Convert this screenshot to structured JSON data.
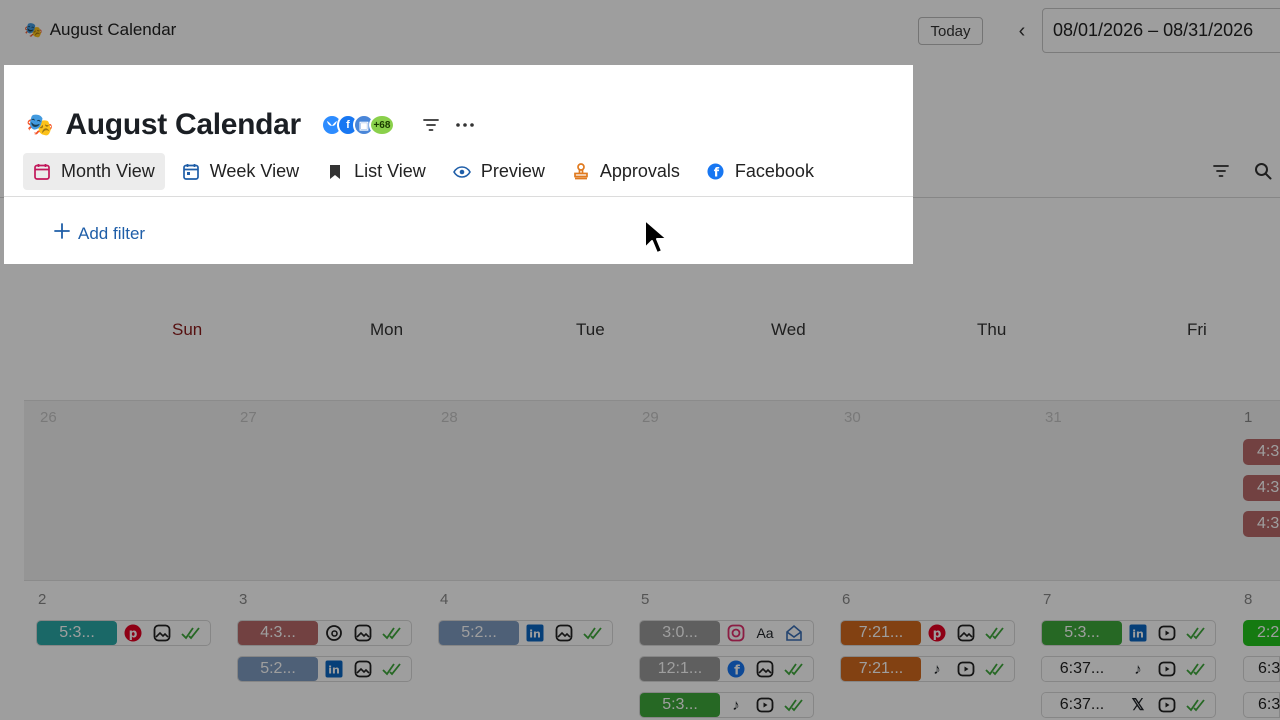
{
  "app": {
    "title": "August Calendar",
    "emoji": "🎭"
  },
  "topbar": {
    "today_label": "Today",
    "prev_label": "‹",
    "date_range": "08/01/2026  – 08/31/2026"
  },
  "panel": {
    "title": "August Calendar",
    "emoji": "🎭",
    "avatar_count": "+68",
    "tabs": [
      {
        "label": "Month View",
        "icon": "calendar-icon",
        "active": true
      },
      {
        "label": "Week View",
        "icon": "calendar-icon"
      },
      {
        "label": "List View",
        "icon": "bookmark-icon"
      },
      {
        "label": "Preview",
        "icon": "eye-icon"
      },
      {
        "label": "Approvals",
        "icon": "stamp-icon"
      },
      {
        "label": "Facebook",
        "icon": "facebook-icon"
      }
    ],
    "add_filter_label": "Add filter"
  },
  "calendar": {
    "weekdays": [
      "Sun",
      "Mon",
      "Tue",
      "Wed",
      "Thu",
      "Fri"
    ],
    "row1_days": [
      "26",
      "27",
      "28",
      "29",
      "30",
      "31",
      "1"
    ],
    "row2_days": [
      "2",
      "3",
      "4",
      "5",
      "6",
      "7",
      "8"
    ],
    "events": {
      "sun": [
        "5:3..."
      ],
      "mon": [
        "4:3...",
        "5:2..."
      ],
      "tue": [
        "5:2..."
      ],
      "wed": [
        "3:0...",
        "12:1...",
        "5:3..."
      ],
      "thu": [
        "7:21...",
        "7:21..."
      ],
      "fri": [
        "5:3...",
        "6:37...",
        "6:37..."
      ],
      "sat_row1": [
        "4:3",
        "4:3",
        "4:3"
      ],
      "sat_row2": [
        "2:2",
        "6:3",
        "6:3"
      ]
    }
  },
  "colors": {
    "accent_blue": "#1f5ea8",
    "sunday_red": "#8b1b1b",
    "teal": "#2aa9a6",
    "rose": "#b86a6a",
    "slate": "#7f9bc1",
    "gray": "#9a9a9a",
    "green": "#3ea83a",
    "orange": "#d2691e",
    "bright_green": "#22c51c"
  }
}
